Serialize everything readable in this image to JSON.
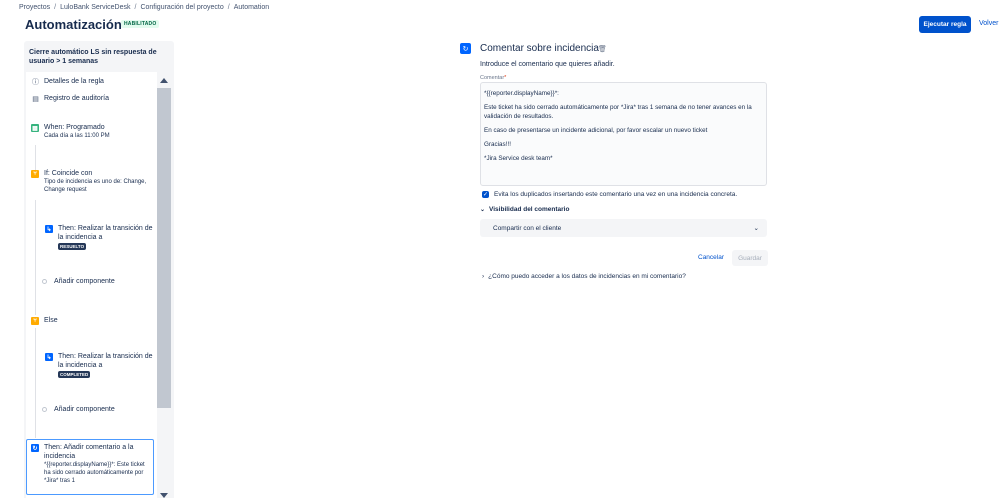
{
  "breadcrumb": [
    "Proyectos",
    "LuloBank ServiceDesk",
    "Configuración del proyecto",
    "Automation"
  ],
  "header": {
    "title": "Automatización",
    "status": "HABILITADO",
    "run_button": "Ejecutar regla",
    "back_link": "Volver"
  },
  "rule": {
    "name": "Cierre automático LS sin respuesta de usuario > 1 semanas",
    "details": "Detalles de la regla",
    "audit": "Registro de auditoría",
    "trigger_title": "When: Programado",
    "trigger_sub": "Cada día a las 11:00 PM",
    "condition_title": "If: Coincide con",
    "condition_sub": "Tipo de incidencia es uno de: Change, Change request",
    "action1_title": "Then: Realizar la transición de la incidencia a",
    "action1_tag": "RESUELTO",
    "add_component_1": "Añadir componente",
    "else_label": "Else",
    "action2_title": "Then: Realizar la transición de la incidencia a",
    "action2_tag": "COMPLETED",
    "add_component_2": "Añadir componente",
    "action3_title": "Then: Añadir comentario a la incidencia",
    "action3_sub": "*{{reporter.displayName}}*: Este ticket ha sido cerrado automáticamente por *Jira* tras 1"
  },
  "editor": {
    "title": "Comentar sobre incidencia",
    "description": "Introduce el comentario que quieres añadir.",
    "field_label": "Comentar",
    "required_mark": "*",
    "comment_lines": [
      "*{{reporter.displayName}}*:",
      "Este ticket ha sido cerrado automáticamente por *Jira* tras 1 semana de no tener avances en la validación de resultados.",
      "En caso de presentarse un incidente adicional, por favor escalar un nuevo ticket",
      "Gracias!!!",
      "*Jira Service desk team*"
    ],
    "dedupe_checkbox": "Evita los duplicados insertando este comentario una vez en una incidencia concreta.",
    "dedupe_checked": true,
    "visibility_label": "Visibilidad del comentario",
    "visibility_value": "Compartir con el cliente",
    "cancel": "Cancelar",
    "save": "Guardar",
    "faq": "¿Cómo puedo acceder a los datos de incidencias en mi comentario?"
  },
  "colors": {
    "primary": "#0052cc",
    "trigger": "#36b37e",
    "condition": "#ffab00",
    "action": "#0065ff",
    "status_bg": "#e3fcef",
    "status_text": "#006644"
  },
  "icons": {
    "details": "info-icon",
    "audit": "document-icon",
    "trigger": "calendar-icon",
    "condition": "branch-icon",
    "action": "transition-icon",
    "comment": "comment-action-icon",
    "trash": "trash-icon"
  }
}
